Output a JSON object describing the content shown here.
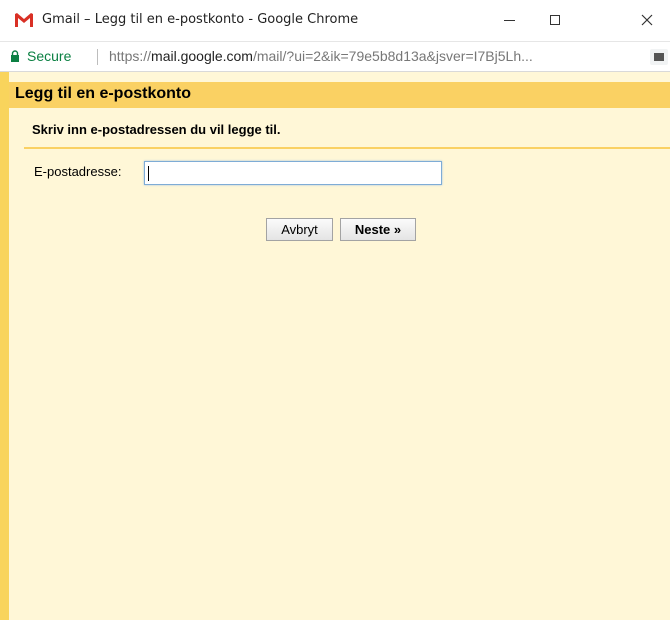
{
  "window": {
    "title": "Gmail – Legg til en e-postkonto - Google Chrome"
  },
  "addressbar": {
    "secure_label": "Secure",
    "url_scheme": "https://",
    "url_host": "mail.google.com",
    "url_rest": "/mail/?ui=2&ik=79e5b8d13a&jsver=I7Bj5Lh..."
  },
  "dialog": {
    "title": "Legg til en e-postkonto",
    "instruction": "Skriv inn e-postadressen du vil legge til.",
    "email_label": "E-postadresse:",
    "email_value": "",
    "cancel_label": "Avbryt",
    "next_label": "Neste »"
  },
  "colors": {
    "header": "#fad163",
    "background": "#fff7d7",
    "secure": "#0b8043"
  }
}
